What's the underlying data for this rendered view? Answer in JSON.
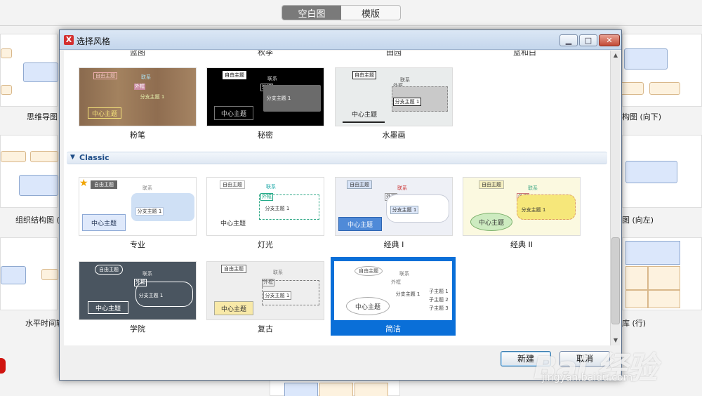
{
  "top_tabs": {
    "blank": "空白图",
    "template": "模版"
  },
  "background_gallery": {
    "left": [
      "思维导图",
      "组织结构图 (向",
      "水平时间轴"
    ],
    "right": [
      "构图 (向下)",
      "图 (向左)",
      "库 (行)"
    ]
  },
  "dialog": {
    "title": "选择风格",
    "app_icon_text": "X",
    "window_buttons": {
      "minimize": "▁",
      "maximize": "□",
      "close": "✕"
    },
    "cut_off_labels": [
      "蓝图",
      "秋季",
      "田园",
      "蓝和白"
    ],
    "first_row": [
      {
        "label": "粉笔",
        "center": "中心主题",
        "free": "自由主题",
        "branch": "分支主题 1",
        "rel": "联系",
        "outline": "外框"
      },
      {
        "label": "秘密",
        "center": "中心主题",
        "free": "自由主题",
        "branch": "分支主题 1",
        "rel": "联系",
        "outline": "外框"
      },
      {
        "label": "水墨画",
        "center": "中心主题",
        "free": "自由主题",
        "branch": "分支主题 1",
        "rel": "联系",
        "outline": "外框"
      }
    ],
    "group": {
      "caret": "▼",
      "label": "Classic"
    },
    "classic": [
      {
        "label": "专业",
        "center": "中心主题",
        "free": "自由主题",
        "branch": "分支主题 1",
        "rel": "联系",
        "outline": "外框",
        "star": "★"
      },
      {
        "label": "灯光",
        "center": "中心主题",
        "free": "自由主题",
        "branch": "分支主题 1",
        "rel": "联系",
        "outline": "外框"
      },
      {
        "label": "经典 I",
        "center": "中心主题",
        "free": "自由主题",
        "branch": "分支主题 1",
        "rel": "联系",
        "outline": "外框"
      },
      {
        "label": "经典 II",
        "center": "中心主题",
        "free": "自由主题",
        "branch": "分支主题 1",
        "rel": "联系",
        "outline": "外框"
      },
      {
        "label": "学院",
        "center": "中心主题",
        "free": "自由主题",
        "branch": "分支主题 1",
        "rel": "联系",
        "outline": "外框"
      },
      {
        "label": "复古",
        "center": "中心主题",
        "free": "自由主题",
        "branch": "分支主题 1",
        "rel": "联系",
        "outline": "外框"
      },
      {
        "label": "简洁",
        "center": "中心主题",
        "free": "自由主题",
        "branch": "分支主题 1",
        "rel": "联系",
        "outline": "外框",
        "selected": true
      }
    ],
    "subtopics": [
      "子主题 1",
      "子主题 2",
      "子主题 3"
    ],
    "buttons": {
      "new": "新建",
      "cancel": "取消"
    }
  },
  "watermark": {
    "logo": "Bai 经验",
    "url": "jingyan.baidu.com"
  },
  "colors": {
    "selection": "#0a6fd8",
    "accent_header": "#1f4d87",
    "close_button": "#c24a36"
  }
}
